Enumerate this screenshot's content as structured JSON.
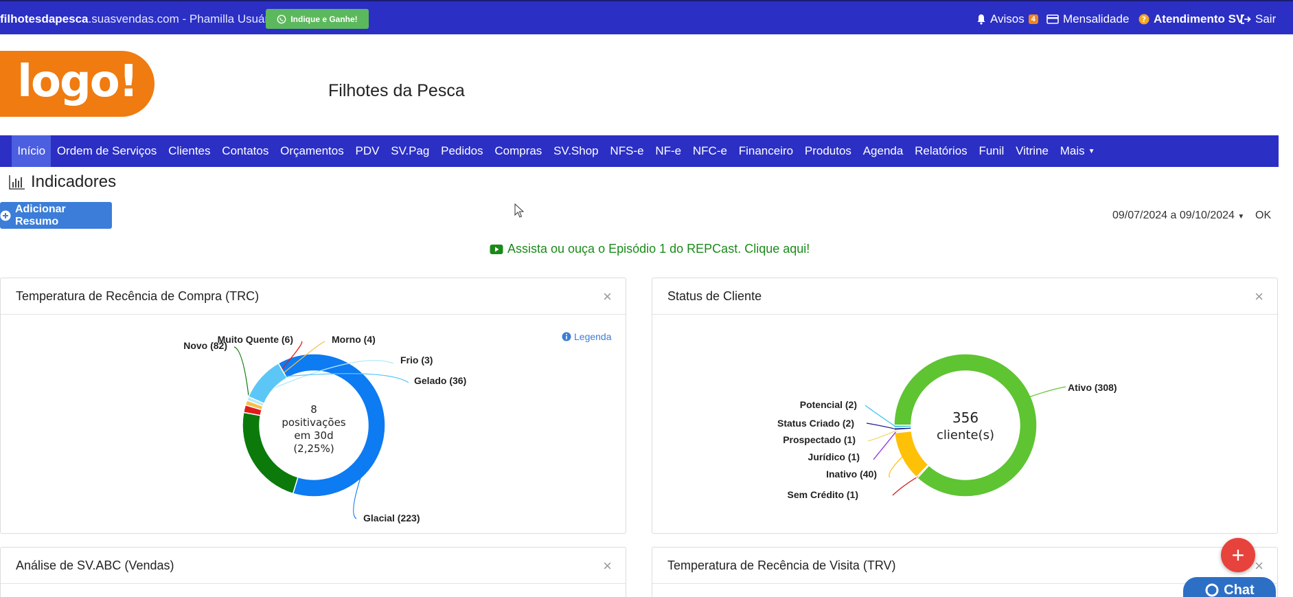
{
  "topbar": {
    "site_bold": "filhotesdapesca",
    "site_rest": ".suasvendas.com - Phamilla Usuária SV",
    "indique_label": "Indique e Ganhe!",
    "avisos_label": "Avisos",
    "avisos_count": "4",
    "mensalidade_label": "Mensalidade",
    "atendimento_label": "Atendimento SV",
    "sair_label": "Sair"
  },
  "logo_text": "logo!",
  "company_name": "Filhotes da Pesca",
  "nav": {
    "items": [
      "Início",
      "Ordem de Serviços",
      "Clientes",
      "Contatos",
      "Orçamentos",
      "PDV",
      "SV.Pag",
      "Pedidos",
      "Compras",
      "SV.Shop",
      "NFS-e",
      "NF-e",
      "NFC-e",
      "Financeiro",
      "Produtos",
      "Agenda",
      "Relatórios",
      "Funil",
      "Vitrine",
      "Mais"
    ],
    "active": "Início"
  },
  "page_title": "Indicadores",
  "add_button_label": "Adicionar Resumo",
  "date_range": "09/07/2024 a 09/10/2024",
  "ok_label": "OK",
  "repcast_text": "Assista ou ouça o Episódio 1 do REPCast. Clique aqui!",
  "panels": {
    "trc_title": "Temperatura de Recência de Compra (TRC)",
    "status_title": "Status de Cliente",
    "abc_title": "Análise de SV.ABC (Vendas)",
    "trv_title": "Temperatura de Recência de Visita (TRV)",
    "close_symbol": "×",
    "legend_link": "Legenda"
  },
  "chat_label": "Chat",
  "fab_symbol": "+",
  "chart_data": [
    {
      "type": "pie",
      "title": "Temperatura de Recência de Compra (TRC)",
      "donut": true,
      "center_text": [
        "8",
        "positivações",
        "em 30d",
        "(2,25%)"
      ],
      "slices": [
        {
          "label": "Glacial (223)",
          "value": 223,
          "color": "#0d7bf2"
        },
        {
          "label": "Novo (82)",
          "value": 82,
          "color": "#0b7a0b"
        },
        {
          "label": "Muito Quente (6)",
          "value": 6,
          "color": "#e01b1b"
        },
        {
          "label": "Morno (4)",
          "value": 4,
          "color": "#f5c04a"
        },
        {
          "label": "Frio (3)",
          "value": 3,
          "color": "#b5e9f7"
        },
        {
          "label": "Gelado (36)",
          "value": 36,
          "color": "#5cc7f7"
        }
      ]
    },
    {
      "type": "pie",
      "title": "Status de Cliente",
      "donut": true,
      "center_text": [
        "356",
        "cliente(s)"
      ],
      "slices": [
        {
          "label": "Ativo (308)",
          "value": 308,
          "color": "#5ec432"
        },
        {
          "label": "Sem Crédito (1)",
          "value": 1,
          "color": "#d42020"
        },
        {
          "label": "Inativo (40)",
          "value": 40,
          "color": "#ffc107"
        },
        {
          "label": "Jurídico (1)",
          "value": 1,
          "color": "#8b2be2"
        },
        {
          "label": "Prospectado (1)",
          "value": 1,
          "color": "#f5d76e"
        },
        {
          "label": "Status Criado (2)",
          "value": 2,
          "color": "#1a1a8c"
        },
        {
          "label": "Potencial (2)",
          "value": 2,
          "color": "#34c6e8"
        }
      ]
    }
  ]
}
